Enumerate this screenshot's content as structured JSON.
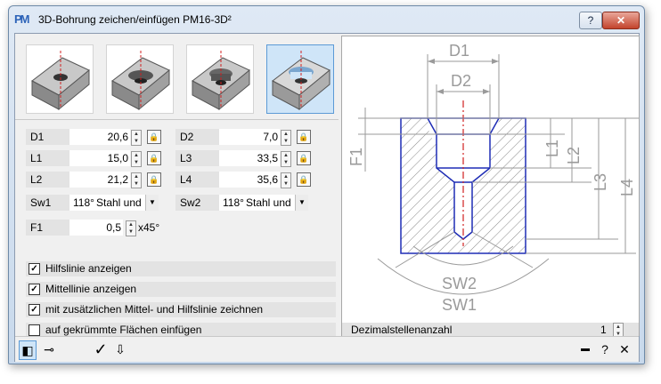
{
  "window": {
    "title": "3D-Bohrung zeichen/einfügen  PM16-3D²",
    "logo_text": "PM",
    "help_glyph": "?",
    "close_glyph": "✕"
  },
  "thumbnails": [
    {
      "name": "simple-bore",
      "selected": false
    },
    {
      "name": "countersink-bore",
      "selected": false
    },
    {
      "name": "counterbore",
      "selected": false
    },
    {
      "name": "counterbore-countersink",
      "selected": true
    }
  ],
  "params": {
    "D1": {
      "label": "D1",
      "value": "20,6"
    },
    "D2": {
      "label": "D2",
      "value": "7,0"
    },
    "L1": {
      "label": "L1",
      "value": "15,0"
    },
    "L3": {
      "label": "L3",
      "value": "33,5"
    },
    "L2": {
      "label": "L2",
      "value": "21,2"
    },
    "L4": {
      "label": "L4",
      "value": "35,6"
    },
    "Sw1": {
      "label": "Sw1",
      "angle": "118°",
      "material": "Stahl und"
    },
    "Sw2": {
      "label": "Sw2",
      "angle": "118°",
      "material": "Stahl und"
    },
    "F1": {
      "label": "F1",
      "value": "0,5",
      "unit": "x45°"
    }
  },
  "checkboxes": [
    {
      "label": "Hilfslinie anzeigen",
      "checked": true
    },
    {
      "label": "Mittellinie anzeigen",
      "checked": true
    },
    {
      "label": "mit zusätzlichen Mittel- und Hilfslinie zeichnen",
      "checked": true
    },
    {
      "label": "auf gekrümmte Flächen einfügen",
      "checked": false
    }
  ],
  "drawing": {
    "labels": {
      "d1": "D1",
      "d2": "D2",
      "f1": "F1",
      "l1": "L1",
      "l2": "L2",
      "l3": "L3",
      "l4": "L4",
      "sw2": "SW2",
      "sw1": "SW1"
    }
  },
  "decimal": {
    "label": "Dezimalstellenanzahl",
    "value": "1"
  },
  "status": {
    "help_glyph": "?",
    "close_glyph": "✕",
    "minimize_glyph": "▬"
  },
  "colors": {
    "outline": "#1f2db5",
    "centerline": "#d02020",
    "dimension": "#9a9a9a",
    "selected_bg": "#cfe5f8"
  }
}
